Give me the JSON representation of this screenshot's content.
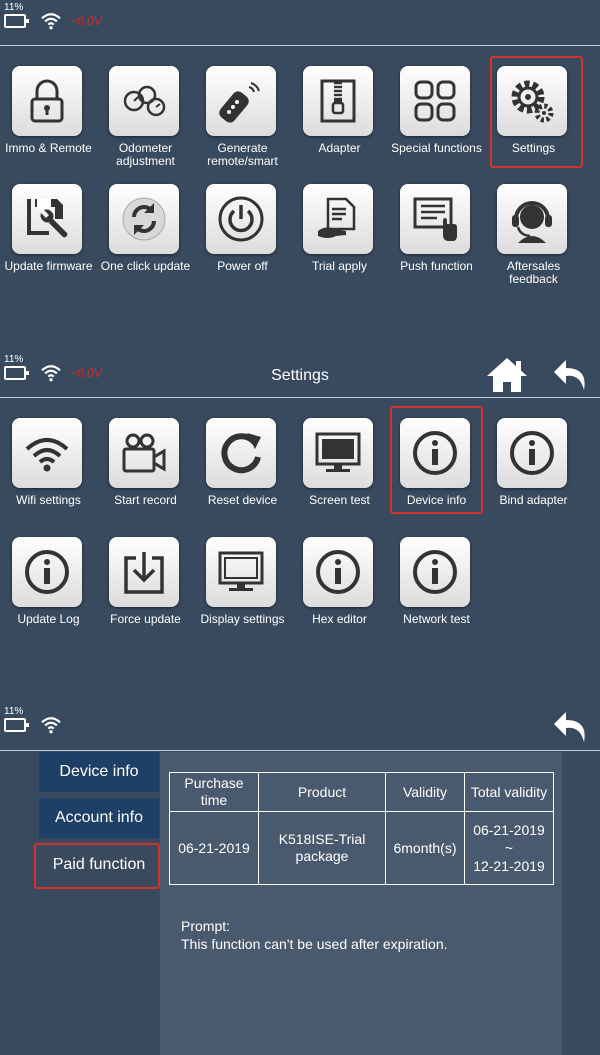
{
  "colors": {
    "background": "#3a4a5e",
    "highlight": "#d62f2f",
    "nav_active": "#1e3f66"
  },
  "screen1": {
    "status": {
      "battery": "11%",
      "voltage": "~0.0V"
    },
    "tiles": [
      {
        "label": "Immo & Remote",
        "icon": "lock-icon"
      },
      {
        "label": "Odometer adjustment",
        "icon": "odometer-icon"
      },
      {
        "label": "Generate remote/smart",
        "icon": "remote-key-icon"
      },
      {
        "label": "Adapter",
        "icon": "adapter-icon"
      },
      {
        "label": "Special functions",
        "icon": "grid-icon"
      },
      {
        "label": "Settings",
        "icon": "gear-icon"
      },
      {
        "label": "Update firmware",
        "icon": "save-wrench-icon"
      },
      {
        "label": "One click update",
        "icon": "refresh-icon"
      },
      {
        "label": "Power off",
        "icon": "power-icon"
      },
      {
        "label": "Trial apply",
        "icon": "document-hand-icon"
      },
      {
        "label": "Push function",
        "icon": "push-icon"
      },
      {
        "label": "Aftersales feedback",
        "icon": "headset-icon"
      }
    ]
  },
  "screen2": {
    "status": {
      "battery": "11%",
      "voltage": "~0.0V"
    },
    "title": "Settings",
    "tiles": [
      {
        "label": "Wifi settings",
        "icon": "wifi-icon"
      },
      {
        "label": "Start record",
        "icon": "camera-icon"
      },
      {
        "label": "Reset device",
        "icon": "reset-icon"
      },
      {
        "label": "Screen test",
        "icon": "monitor-icon"
      },
      {
        "label": "Device info",
        "icon": "info-icon"
      },
      {
        "label": "Bind adapter",
        "icon": "info-icon"
      },
      {
        "label": "Update Log",
        "icon": "info-icon"
      },
      {
        "label": "Force update",
        "icon": "download-icon"
      },
      {
        "label": "Display settings",
        "icon": "monitor-icon"
      },
      {
        "label": "Hex editor",
        "icon": "info-icon"
      },
      {
        "label": "Network test",
        "icon": "info-icon"
      }
    ]
  },
  "screen3": {
    "status": {
      "battery": "11%"
    },
    "nav": [
      "Device info",
      "Account info",
      "Paid function"
    ],
    "table": {
      "headers": [
        "Purchase time",
        "Product",
        "Validity",
        "Total validity"
      ],
      "row": {
        "purchase": "06-21-2019",
        "product": "K518ISE-Trial package",
        "validity": "6month(s)",
        "total_from": "06-21-2019",
        "total_sep": "~",
        "total_to": "12-21-2019"
      }
    },
    "prompt_label": "Prompt:",
    "prompt_text": "This function can't be used after expiration."
  }
}
